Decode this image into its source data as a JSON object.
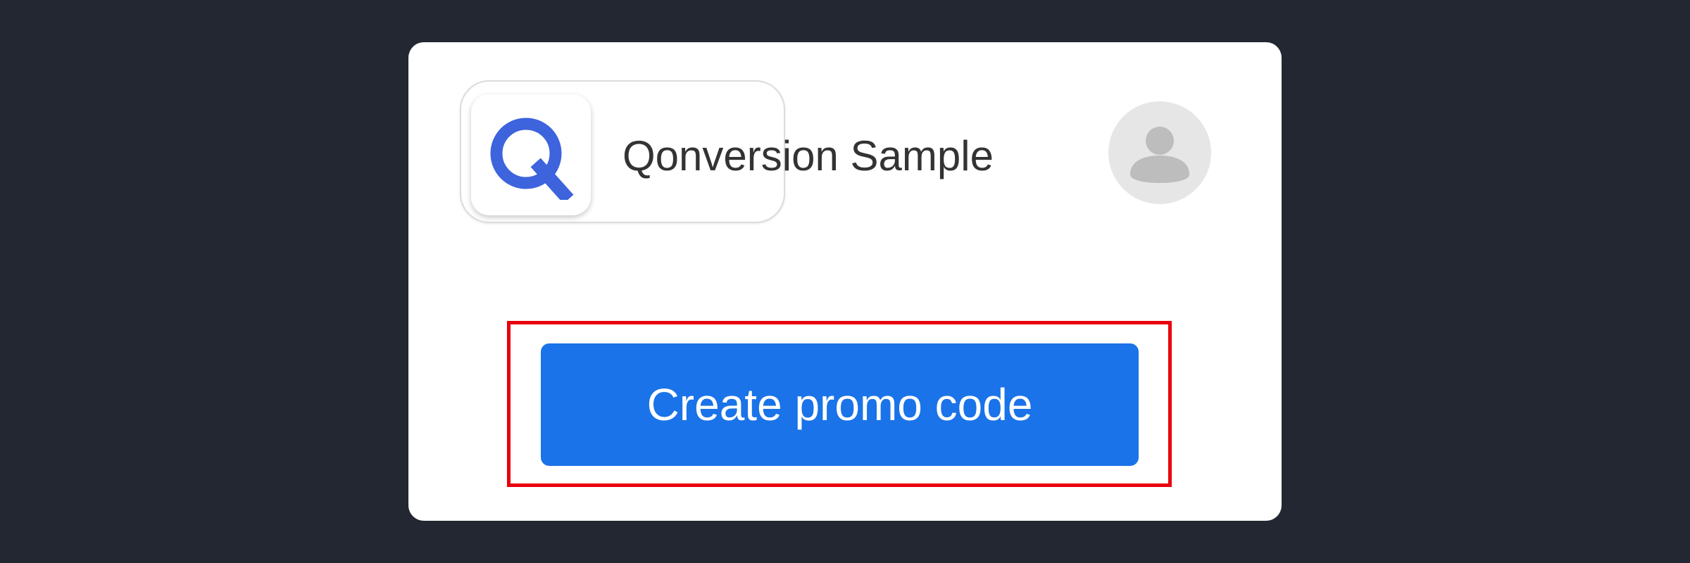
{
  "app": {
    "name": "Qonversion Sample",
    "logo_letter": "Q",
    "logo_color": "#3d63dd",
    "logo_icon": "q-logo-icon"
  },
  "account": {
    "avatar_icon": "person-avatar-icon"
  },
  "actions": {
    "create_promo_label": "Create promo code",
    "button_color": "#1a73e8",
    "highlight_color": "#e8000d"
  }
}
